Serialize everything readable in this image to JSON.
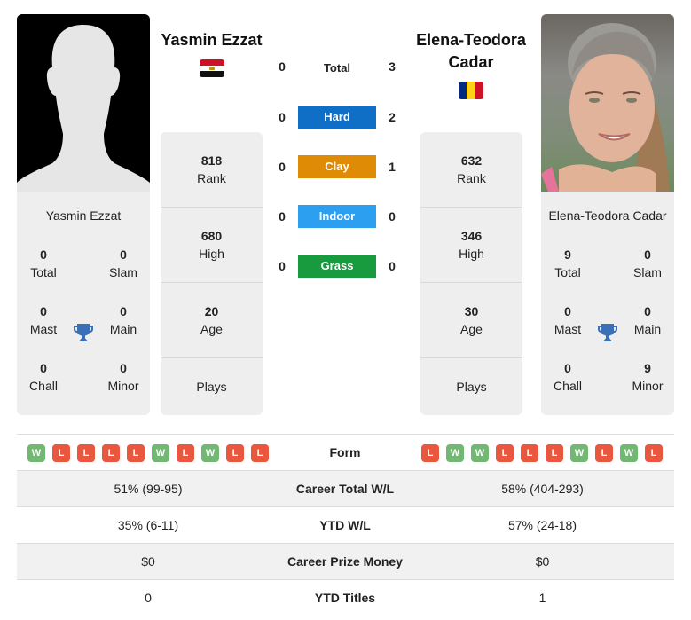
{
  "player1": {
    "name": "Yasmin Ezzat",
    "photo": "silhouette-placeholder",
    "flag": "egypt-flag",
    "titles": {
      "total": {
        "value": "0",
        "label": "Total"
      },
      "slam": {
        "value": "0",
        "label": "Slam"
      },
      "mast": {
        "value": "0",
        "label": "Mast"
      },
      "main": {
        "value": "0",
        "label": "Main"
      },
      "chall": {
        "value": "0",
        "label": "Chall"
      },
      "minor": {
        "value": "0",
        "label": "Minor"
      }
    },
    "stats": {
      "rank": {
        "value": "818",
        "label": "Rank"
      },
      "high": {
        "value": "680",
        "label": "High"
      },
      "age": {
        "value": "20",
        "label": "Age"
      },
      "plays": {
        "value": "",
        "label": "Plays"
      }
    },
    "form": [
      "W",
      "L",
      "L",
      "L",
      "L",
      "W",
      "L",
      "W",
      "L",
      "L"
    ]
  },
  "player2": {
    "name": "Elena-Teodora Cadar",
    "name_line1": "Elena-Teodora",
    "name_line2": "Cadar",
    "photo": "player-portrait",
    "flag": "romania-flag",
    "titles": {
      "total": {
        "value": "9",
        "label": "Total"
      },
      "slam": {
        "value": "0",
        "label": "Slam"
      },
      "mast": {
        "value": "0",
        "label": "Mast"
      },
      "main": {
        "value": "0",
        "label": "Main"
      },
      "chall": {
        "value": "0",
        "label": "Chall"
      },
      "minor": {
        "value": "9",
        "label": "Minor"
      }
    },
    "stats": {
      "rank": {
        "value": "632",
        "label": "Rank"
      },
      "high": {
        "value": "346",
        "label": "High"
      },
      "age": {
        "value": "30",
        "label": "Age"
      },
      "plays": {
        "value": "",
        "label": "Plays"
      }
    },
    "form": [
      "L",
      "W",
      "W",
      "L",
      "L",
      "L",
      "W",
      "L",
      "W",
      "L"
    ]
  },
  "h2h": [
    {
      "surface": "Total",
      "p1": "0",
      "p2": "3",
      "color": ""
    },
    {
      "surface": "Hard",
      "p1": "0",
      "p2": "2",
      "color": "#0f6fc6"
    },
    {
      "surface": "Clay",
      "p1": "0",
      "p2": "1",
      "color": "#e08b06"
    },
    {
      "surface": "Indoor",
      "p1": "0",
      "p2": "0",
      "color": "#2c9ff0"
    },
    {
      "surface": "Grass",
      "p1": "0",
      "p2": "0",
      "color": "#189b3e"
    }
  ],
  "table": {
    "form_label": "Form",
    "rows": [
      {
        "label": "Career Total W/L",
        "p1": "51% (99-95)",
        "p2": "58% (404-293)"
      },
      {
        "label": "YTD W/L",
        "p1": "35% (6-11)",
        "p2": "57% (24-18)"
      },
      {
        "label": "Career Prize Money",
        "p1": "$0",
        "p2": "$0"
      },
      {
        "label": "YTD Titles",
        "p1": "0",
        "p2": "1"
      }
    ]
  },
  "colors": {
    "win": "#72b872",
    "loss": "#e9573f",
    "trophy": "#3b6fb6"
  }
}
